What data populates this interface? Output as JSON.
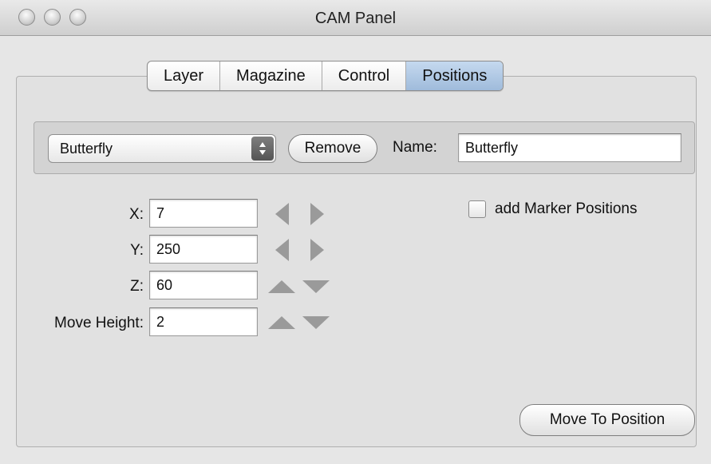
{
  "window": {
    "title": "CAM Panel"
  },
  "tabs": [
    {
      "label": "Layer",
      "active": false
    },
    {
      "label": "Magazine",
      "active": false
    },
    {
      "label": "Control",
      "active": false
    },
    {
      "label": "Positions",
      "active": true
    }
  ],
  "position_bar": {
    "selected_position": "Butterfly",
    "remove_label": "Remove",
    "name_label": "Name:",
    "name_value": "Butterfly"
  },
  "coordinates": {
    "x": {
      "label": "X:",
      "value": "7"
    },
    "y": {
      "label": "Y:",
      "value": "250"
    },
    "z": {
      "label": "Z:",
      "value": "60"
    },
    "move_height": {
      "label": "Move Height:",
      "value": "2"
    }
  },
  "marker_option": {
    "label": "add Marker Positions",
    "checked": false
  },
  "actions": {
    "move_to_position_label": "Move To Position"
  },
  "icons": {
    "window_controls": [
      "close-icon",
      "minimize-icon",
      "zoom-icon"
    ],
    "select_arrows": "up-down-arrows-icon",
    "xy_steppers": [
      "left-arrow-icon",
      "right-arrow-icon"
    ],
    "z_steppers": [
      "up-arrow-icon",
      "down-arrow-icon"
    ]
  },
  "colors": {
    "active_tab": "#a9c4e2",
    "window_bg": "#e6e6e6"
  }
}
